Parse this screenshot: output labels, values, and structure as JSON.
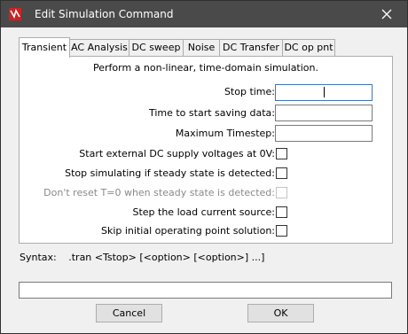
{
  "window": {
    "title": "Edit Simulation Command"
  },
  "tabs": [
    {
      "label": "Transient"
    },
    {
      "label": "AC Analysis"
    },
    {
      "label": "DC sweep"
    },
    {
      "label": "Noise"
    },
    {
      "label": "DC Transfer"
    },
    {
      "label": "DC op pnt"
    }
  ],
  "transient": {
    "description": "Perform a non-linear, time-domain simulation.",
    "stop_time": {
      "label": "Stop time:",
      "value": ""
    },
    "start_saving": {
      "label": "Time to start saving data:",
      "value": ""
    },
    "max_timestep": {
      "label": "Maximum Timestep:",
      "value": ""
    },
    "ext_dc_zero": {
      "label": "Start external DC supply voltages at 0V:",
      "checked": false
    },
    "stop_steady": {
      "label": "Stop simulating if steady state is detected:",
      "checked": false
    },
    "dont_reset": {
      "label": "Don't reset T=0 when steady state is detected:",
      "checked": false,
      "enabled": false
    },
    "step_load": {
      "label": "Step the load current source:",
      "checked": false
    },
    "skip_op": {
      "label": "Skip initial operating point solution:",
      "checked": false
    }
  },
  "syntax": {
    "label": "Syntax:",
    "text": ".tran <Tstop> [<option> [<option>] ...]"
  },
  "command_line": {
    "value": ""
  },
  "buttons": {
    "cancel": "Cancel",
    "ok": "OK"
  },
  "colors": {
    "titlebar": "#4a4a4a",
    "close_hover": "#e81123",
    "icon_red": "#cc2222"
  }
}
